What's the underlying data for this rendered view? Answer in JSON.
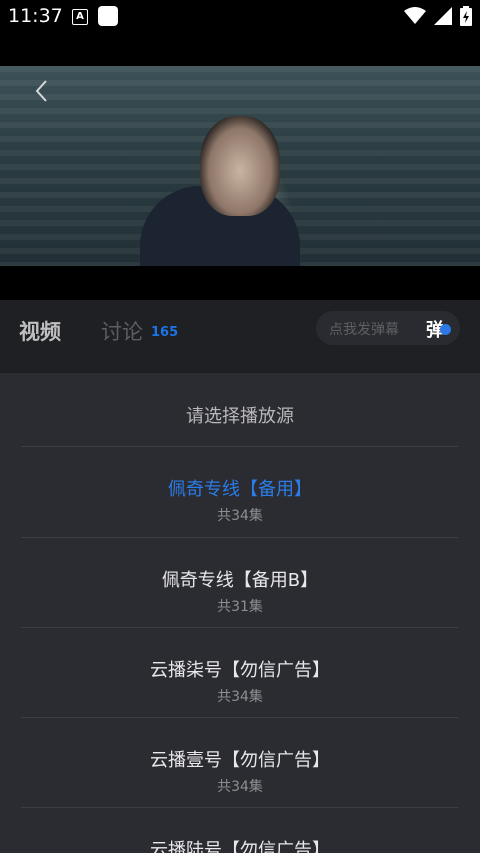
{
  "status_bar": {
    "time": "11:37",
    "app_icon_letter": "A",
    "icons": [
      "wifi-icon",
      "signal-icon",
      "battery-charging-icon"
    ]
  },
  "player": {
    "back_icon": "chevron-left-icon"
  },
  "tabs": {
    "video_label": "视频",
    "discuss_label": "讨论",
    "discuss_count": "165"
  },
  "danmaku": {
    "placeholder": "点我发弹幕",
    "toggle_label": "弹"
  },
  "sheet": {
    "title": "请选择播放源",
    "sources": [
      {
        "name": "佩奇专线【备用】",
        "count": "共34集",
        "selected": true
      },
      {
        "name": "佩奇专线【备用B】",
        "count": "共31集",
        "selected": false
      },
      {
        "name": "云播柒号【勿信广告】",
        "count": "共34集",
        "selected": false
      },
      {
        "name": "云播壹号【勿信广告】",
        "count": "共34集",
        "selected": false
      },
      {
        "name": "云播陆号【勿信广告】",
        "count": "",
        "selected": false
      }
    ]
  },
  "colors": {
    "accent": "#2b7ce9",
    "sheet_bg": "#2b2c31",
    "tabs_bg": "#1f2024"
  }
}
